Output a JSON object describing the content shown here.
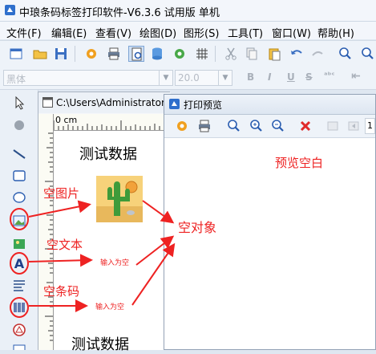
{
  "window": {
    "title": "中琅条码标签打印软件-V6.3.6 试用版 单机"
  },
  "menu": [
    "文件(F)",
    "编辑(E)",
    "查看(V)",
    "绘图(D)",
    "图形(S)",
    "工具(T)",
    "窗口(W)",
    "帮助(H)"
  ],
  "format_bar": {
    "font_name": "黑体",
    "font_size": "20.0",
    "bold": "B",
    "italic": "I",
    "underline": "U",
    "strike": "S",
    "abc": "ᵃᵇᶜ",
    "align_label": "⇤"
  },
  "document": {
    "path": "C:\\Users\\Administrator",
    "ruler_label": "0 cm",
    "text_top": "测试数据",
    "text_bottom": "测试数据",
    "empty_text_placeholder": "输入为空",
    "empty_barcode_placeholder": "输入为空"
  },
  "preview": {
    "title": "打印预览",
    "page_field": "1"
  },
  "annotations": {
    "preview_blank": "预览空白",
    "empty_image": "空图片",
    "empty_text": "空文本",
    "empty_barcode": "空条码",
    "empty_object": "空对象",
    "color": "#ee2222"
  }
}
